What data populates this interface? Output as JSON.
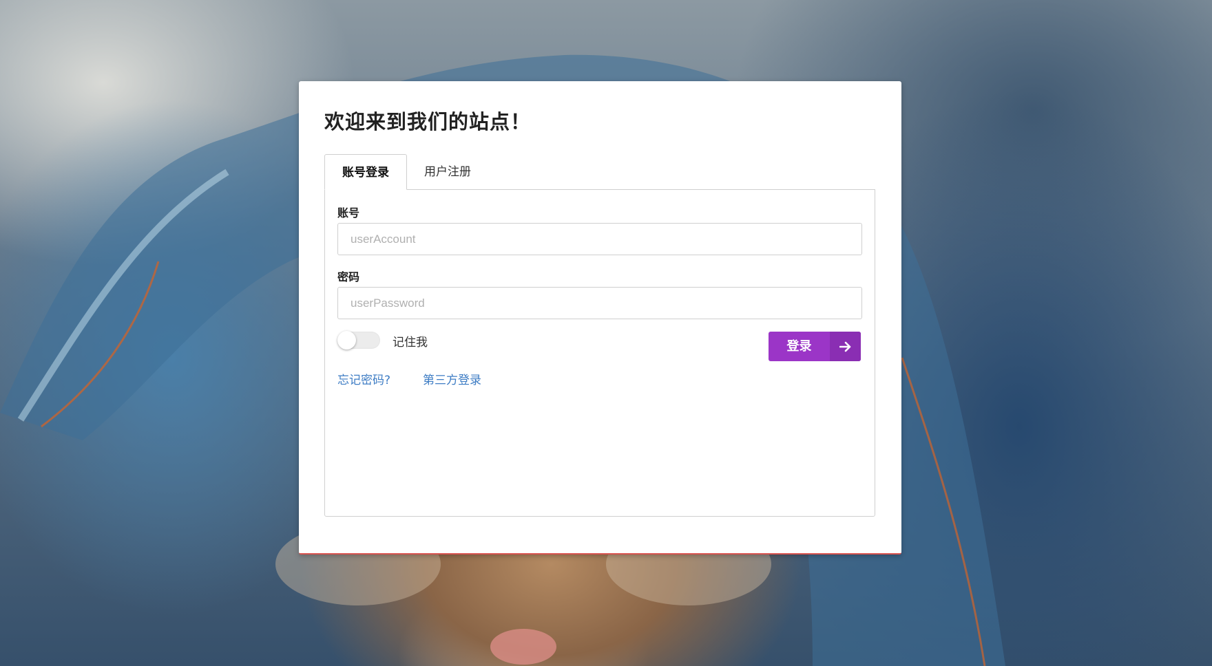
{
  "page": {
    "welcome_title": "欢迎来到我们的站点！"
  },
  "tabs": [
    {
      "label": "账号登录",
      "active": true
    },
    {
      "label": "用户注册",
      "active": false
    }
  ],
  "form": {
    "account_label": "账号",
    "account_placeholder": "userAccount",
    "password_label": "密码",
    "password_placeholder": "userPassword",
    "remember_label": "记住我",
    "remember_checked": false,
    "login_button": "登录",
    "forgot_link": "忘记密码?",
    "third_party_link": "第三方登录"
  },
  "icons": {
    "login_arrow": "arrow-right-icon"
  },
  "colors": {
    "primary_button": "#9b35c7",
    "link": "#3d7cc4",
    "card_bottom_border": "#d9534f"
  }
}
